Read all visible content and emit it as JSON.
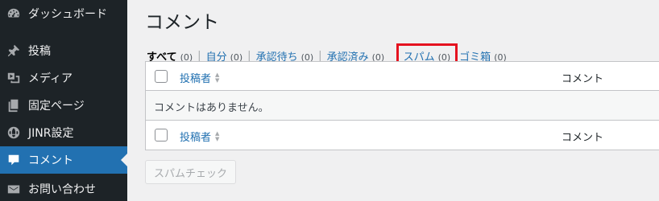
{
  "sidebar": {
    "items": [
      {
        "label": "ダッシュボード",
        "icon": "dashboard-icon",
        "current": false
      },
      {
        "label": "投稿",
        "icon": "pushpin-icon",
        "current": false
      },
      {
        "label": "メディア",
        "icon": "media-icon",
        "current": false
      },
      {
        "label": "固定ページ",
        "icon": "pages-icon",
        "current": false
      },
      {
        "label": "JINR設定",
        "icon": "globe-icon",
        "current": false
      },
      {
        "label": "コメント",
        "icon": "comment-icon",
        "current": true
      },
      {
        "label": "お問い合わせ",
        "icon": "mail-icon",
        "current": false
      }
    ]
  },
  "page": {
    "title": "コメント"
  },
  "filters": {
    "all": {
      "label": "すべて",
      "count": "(0)"
    },
    "mine": {
      "label": "自分",
      "count": "(0)"
    },
    "pending": {
      "label": "承認待ち",
      "count": "(0)"
    },
    "approved": {
      "label": "承認済み",
      "count": "(0)"
    },
    "spam": {
      "label": "スパム",
      "count": "(0)"
    },
    "trash": {
      "label": "ゴミ箱",
      "count": "(0)"
    },
    "separator": "|"
  },
  "table": {
    "col_author": "投稿者",
    "col_comment": "コメント",
    "empty": "コメントはありません。"
  },
  "actions": {
    "empty_spam": "スパムチェック"
  },
  "colors": {
    "accent": "#2271b1",
    "highlight": "#e5121f",
    "sidebar": "#1d2327"
  }
}
